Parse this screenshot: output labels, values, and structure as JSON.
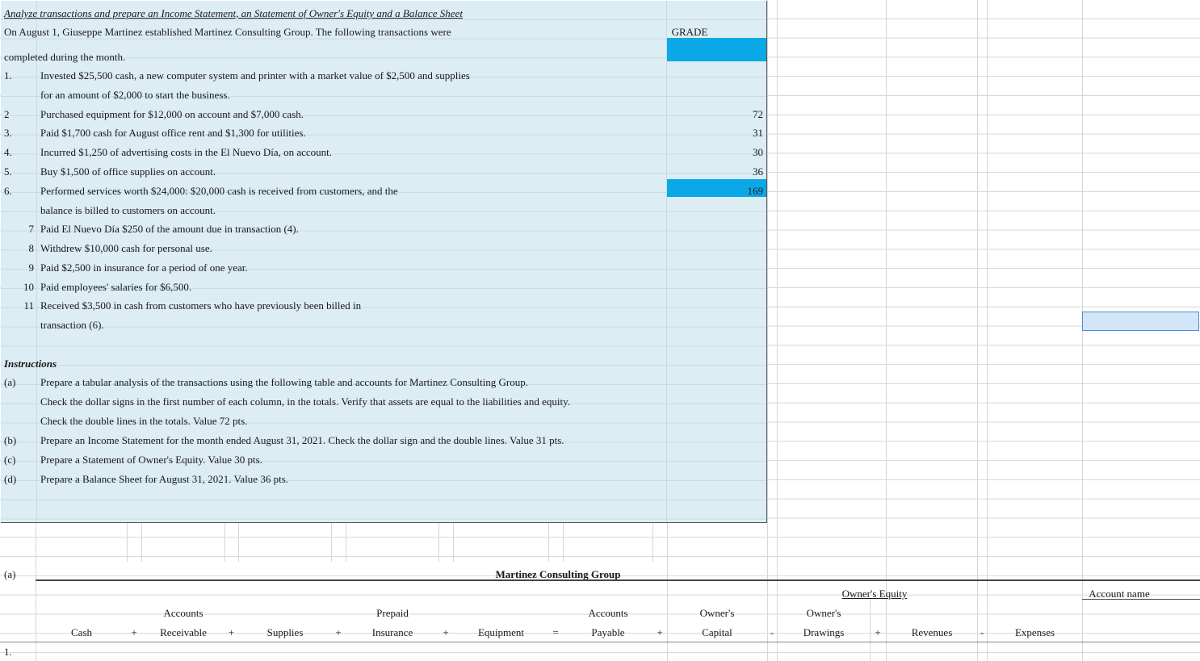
{
  "title": "Analyze transactions and prepare an Income Statement, an Statement of Owner's Equity and a Balance Sheet",
  "intro_line1": "On August 1, Giuseppe Martinez established Martinez Consulting Group.  The following transactions were",
  "intro_line2": "completed during the month.",
  "transactions": [
    {
      "num": "1.",
      "text": "Invested  $25,500 cash, a new computer system and printer with a market value of  $2,500 and supplies"
    },
    {
      "num": "",
      "text": "for an amount of $2,000 to start the business."
    },
    {
      "num": "2",
      "text": "Purchased equipment for $12,000 on account and $7,000 cash."
    },
    {
      "num": "3.",
      "text": "Paid $1,700 cash for August office rent and $1,300 for utilities."
    },
    {
      "num": "4.",
      "text": "Incurred $1,250 of advertising costs in the El Nuevo Día, on account."
    },
    {
      "num": "5.",
      "text": "Buy $1,500 of office supplies on account."
    },
    {
      "num": "6.",
      "text": "Performed services worth $24,000:  $20,000 cash is received from customers, and the"
    },
    {
      "num": "",
      "text": "balance is billed to customers on account."
    },
    {
      "num": "7",
      "text": "Paid El Nuevo Día $250 of the amount due in transaction (4)."
    },
    {
      "num": "8",
      "text": "Withdrew $10,000 cash for personal use."
    },
    {
      "num": "9",
      "text": "Paid $2,500 in insurance for a period of one year."
    },
    {
      "num": "10",
      "text": "Paid employees' salaries for $6,500."
    },
    {
      "num": "11",
      "text": "Received $3,500 in cash from customers who have previously been billed in"
    },
    {
      "num": "",
      "text": "transaction (6)."
    }
  ],
  "grade": {
    "label": "GRADE",
    "values": [
      "72",
      "31",
      "30",
      "36",
      "169"
    ]
  },
  "instructions": {
    "heading": "Instructions",
    "items": [
      {
        "num": "(a)",
        "text": "Prepare a tabular analysis of the transactions using the following table and accounts for Martinez Consulting Group."
      },
      {
        "num": "",
        "text": "Check the dollar signs in the first number of each column, in the totals. Verify that assets are equal to the liabilities and equity."
      },
      {
        "num": "",
        "text": "Check the double lines in the totals. Value 72 pts."
      },
      {
        "num": "(b)",
        "text": "Prepare an Income Statement for the month ended August 31, 2021. Check the dollar sign and the double lines. Value 31 pts."
      },
      {
        "num": "(c)",
        "text": "Prepare a Statement of Owner's Equity. Value 30 pts."
      },
      {
        "num": "(d)",
        "text": "Prepare a Balance Sheet for August 31, 2021. Value 36 pts."
      }
    ]
  },
  "table": {
    "section_label": "(a)",
    "company": "Martinez Consulting Group",
    "owners_equity": "Owner's Equity",
    "account_name": "Account name",
    "headers": {
      "cash": "Cash",
      "ar_top": "Accounts",
      "ar_bottom": "Receivable",
      "supplies": "Supplies",
      "prepaid_top": "Prepaid",
      "prepaid_bottom": "Insurance",
      "equipment": "Equipment",
      "ap_top": "Accounts",
      "ap_bottom": "Payable",
      "capital_top": "Owner's",
      "capital_bottom": "Capital",
      "drawings_top": "Owner's",
      "drawings_bottom": "Drawings",
      "revenues": "Revenues",
      "expenses": "Expenses"
    },
    "operators": {
      "plus": "+",
      "equals": "=",
      "minus": "-"
    },
    "first_row": "1."
  }
}
